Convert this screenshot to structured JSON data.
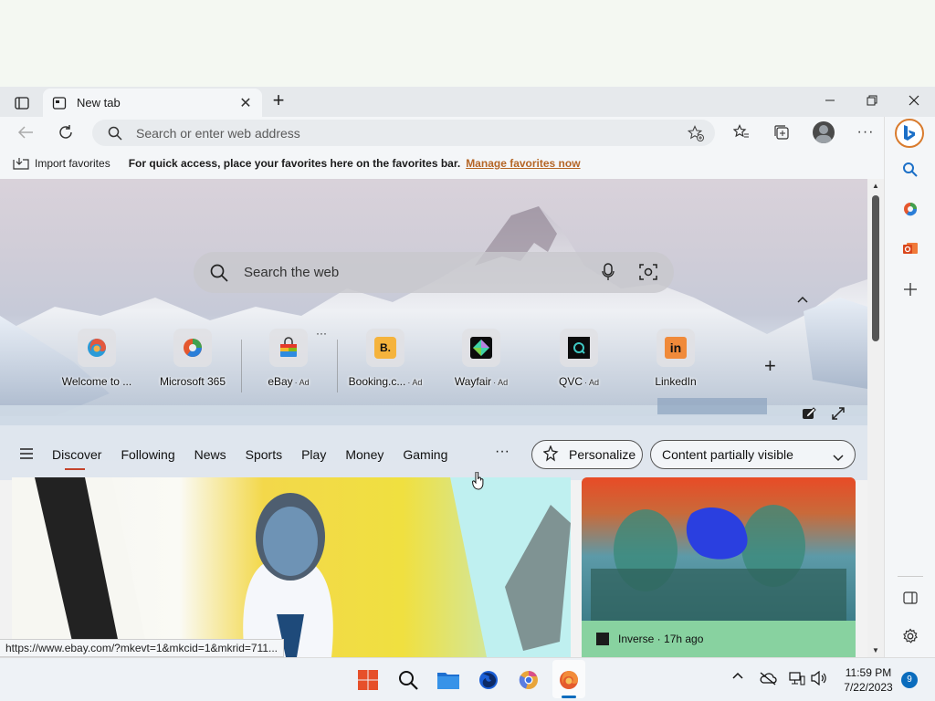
{
  "browser": {
    "tab_title": "New tab",
    "address_placeholder": "Search or enter web address",
    "favorites_bar": {
      "import_label": "Import favorites",
      "message": "For quick access, place your favorites here on the favorites bar.",
      "manage_link": "Manage favorites now"
    },
    "status_url": "https://www.ebay.com/?mkevt=1&mkcid=1&mkrid=711..."
  },
  "newtab": {
    "search_placeholder": "Search the web",
    "tiles": [
      {
        "label": "Welcome to ...",
        "ad": ""
      },
      {
        "label": "Microsoft 365",
        "ad": ""
      },
      {
        "label": "eBay",
        "ad": "· Ad"
      },
      {
        "label": "Booking.c...",
        "ad": "· Ad"
      },
      {
        "label": "Wayfair",
        "ad": "· Ad"
      },
      {
        "label": "QVC",
        "ad": "· Ad"
      },
      {
        "label": "LinkedIn",
        "ad": ""
      }
    ],
    "nav": [
      "Discover",
      "Following",
      "News",
      "Sports",
      "Play",
      "Money",
      "Gaming"
    ],
    "more": "···",
    "personalize": "Personalize",
    "content_visibility": "Content partially visible",
    "side_card_source": "Inverse · 17h ago"
  },
  "taskbar": {
    "time": "11:59 PM",
    "date": "7/22/2023",
    "notification_count": "9"
  },
  "colors": {
    "accent": "#0a6cbd",
    "link": "#b56626",
    "active_underline": "#c4442c"
  }
}
